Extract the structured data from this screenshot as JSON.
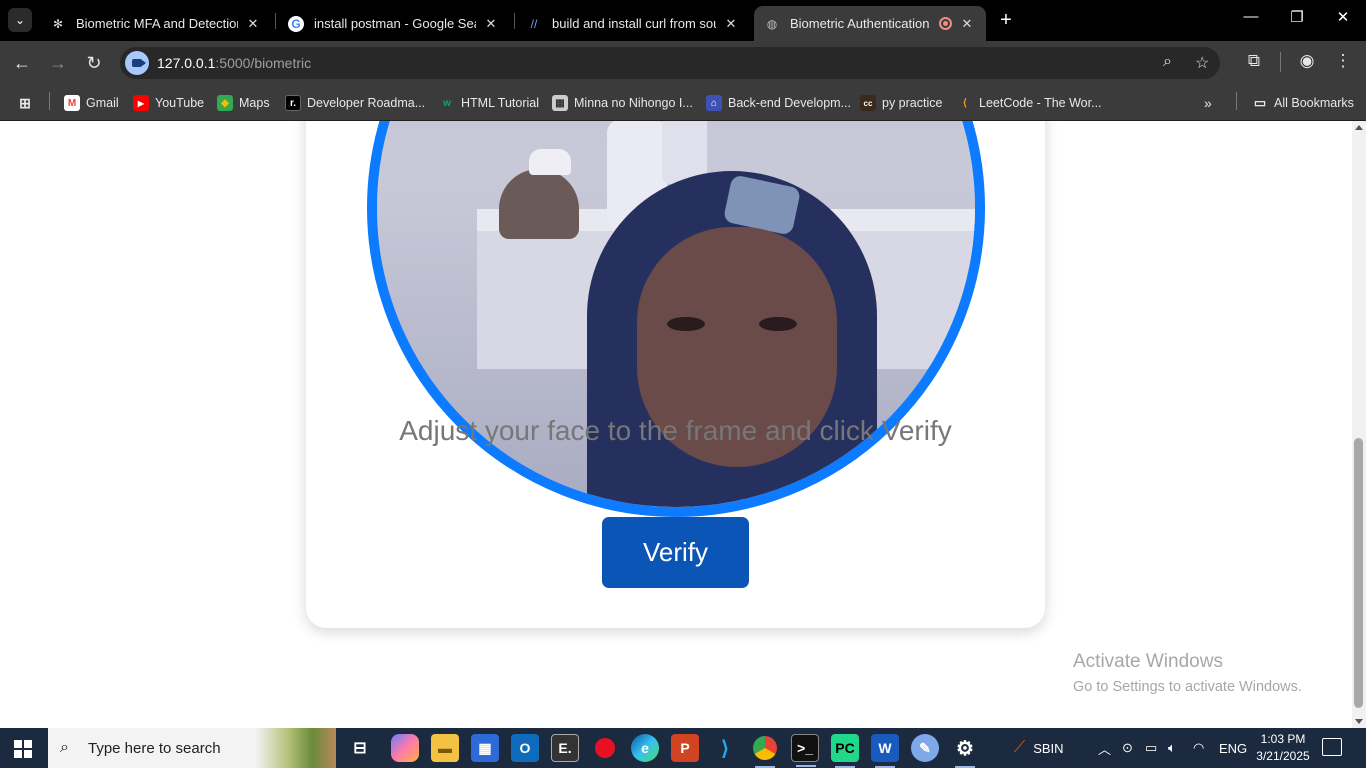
{
  "browser": {
    "tabs": [
      {
        "title": "Biometric MFA and Detection M",
        "favicon": "openai-icon",
        "active": false
      },
      {
        "title": "install postman - Google Search",
        "favicon": "google-icon",
        "active": false
      },
      {
        "title": "build and install curl from source",
        "favicon": "slash-icon",
        "active": false
      },
      {
        "title": "Biometric Authentication",
        "favicon": "globe-icon",
        "active": true,
        "recording": true
      }
    ],
    "address": {
      "host": "127.0.0.1",
      "path": ":5000/biometric"
    },
    "bookmarks": [
      {
        "label": "Gmail",
        "icon": "gmail-icon"
      },
      {
        "label": "YouTube",
        "icon": "youtube-icon"
      },
      {
        "label": "Maps",
        "icon": "maps-icon"
      },
      {
        "label": "Developer Roadma...",
        "icon": "roadmap-icon"
      },
      {
        "label": "HTML Tutorial",
        "icon": "w3schools-icon"
      },
      {
        "label": "Minna no Nihongo I...",
        "icon": "book-icon"
      },
      {
        "label": "Back-end Developm...",
        "icon": "backend-icon"
      },
      {
        "label": "py practice",
        "icon": "cc-icon"
      },
      {
        "label": "LeetCode - The Wor...",
        "icon": "leetcode-icon"
      }
    ],
    "all_bookmarks": "All Bookmarks"
  },
  "page": {
    "instruction": "Adjust your face to the frame and click Verify",
    "verify_label": "Verify",
    "accent_color": "#0d7bff",
    "button_color": "#0b55b6"
  },
  "watermark": {
    "line1": "Activate Windows",
    "line2": "Go to Settings to activate Windows."
  },
  "taskbar": {
    "search_placeholder": "Type here to search",
    "stock": "SBIN",
    "language": "ENG",
    "time": "1:03 PM",
    "date": "3/21/2025"
  }
}
